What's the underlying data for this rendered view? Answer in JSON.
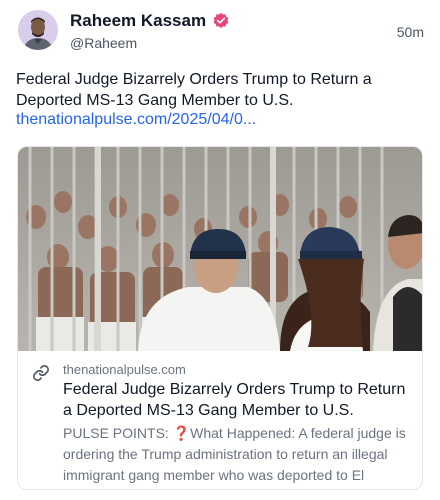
{
  "author": {
    "name": "Raheem Kassam",
    "handle": "@Raheem",
    "verified": true
  },
  "timestamp": "50m",
  "post": {
    "text": "Federal Judge Bizarrely Orders Trump to Return a Deported MS-13 Gang Member to U.S.",
    "link_text": "thenationalpulse.com/2025/04/0..."
  },
  "link_card": {
    "domain": "thenationalpulse.com",
    "title": "Federal Judge Bizarrely Orders Trump to Return a Deported MS-13 Gang Member to U.S.",
    "description_prefix": "PULSE POINTS: ",
    "description_emoji": "❓",
    "description": "What Happened: A federal judge is ordering the Trump administration to return an illegal immigrant gang member who was deported to El",
    "image_icon": "prison-photo"
  },
  "colors": {
    "link": "#2563eb",
    "verified": "#e8457a",
    "muted": "#6b7280"
  }
}
